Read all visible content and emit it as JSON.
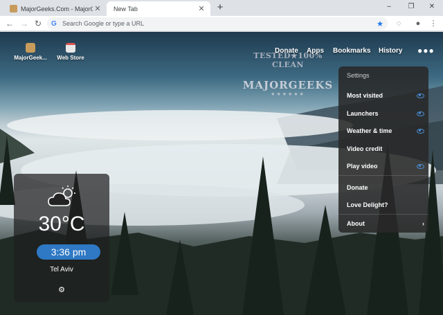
{
  "browser": {
    "tabs": [
      {
        "title": "MajorGeeks.Com - MajorGeeks",
        "active": false
      },
      {
        "title": "New Tab",
        "active": true
      }
    ],
    "new_tab_symbol": "+",
    "window_controls": [
      "–",
      "❐",
      "✕"
    ],
    "omnibox": {
      "placeholder": "Search Google or type a URL",
      "google_letter": "G"
    }
  },
  "shortcuts": [
    {
      "label": "MajorGeek...",
      "icon": "majorgeeks-icon"
    },
    {
      "label": "Web Store",
      "icon": "web-store-icon"
    }
  ],
  "top_nav": [
    "Donate",
    "Apps",
    "Bookmarks",
    "History"
  ],
  "menu_dots": "●●●",
  "watermark": {
    "line1": "TESTED★100% CLEAN",
    "line2": "MAJORGEEKS",
    "line3": "★★★★★★"
  },
  "settings_menu": {
    "title": "Settings",
    "items": [
      {
        "label": "Most visited",
        "toggle": true
      },
      {
        "label": "Launchers",
        "toggle": true
      },
      {
        "label": "Weather & time",
        "toggle": true
      },
      {
        "label": "Video credit",
        "toggle": false
      },
      {
        "label": "Play video",
        "toggle": true
      },
      {
        "label": "Donate",
        "toggle": false
      },
      {
        "label": "Love Delight?",
        "toggle": false
      },
      {
        "label": "About",
        "chevron": "›"
      }
    ]
  },
  "weather": {
    "temperature": "30°C",
    "time": "3:36 pm",
    "city": "Tel Aviv"
  },
  "colors": {
    "accent": "#2f78c4",
    "toggle_on": "#4a90d9",
    "menu_bg": "#282828"
  }
}
